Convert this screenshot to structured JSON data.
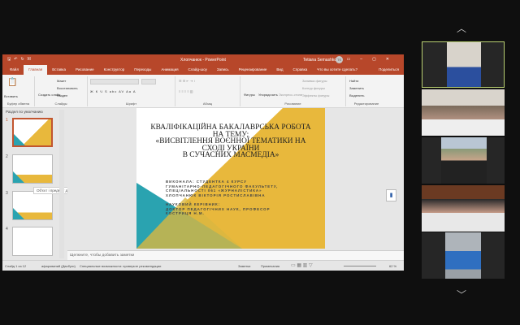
{
  "powerpoint": {
    "window_title": "Хлопчанюк - PowerPoint",
    "user_name": "Tetiana Semashko",
    "user_initials": "TS",
    "tabs": [
      "Файл",
      "Главная",
      "Вставка",
      "Рисование",
      "Конструктор",
      "Переходы",
      "Анимация",
      "Слайд-шоу",
      "Запись",
      "Рецензирование",
      "Вид",
      "Справка"
    ],
    "active_tab": "Главная",
    "tell_me": "Что вы хотите сделать?",
    "share": "Поделиться",
    "ribbon": {
      "paste": "Вставить",
      "new_slide": "Создать слайд",
      "layout": "Макет",
      "reset": "Восстановить",
      "section": "Раздел",
      "font_buttons": "Ж К Ч S abc AV Aa A",
      "shapes": "Фигуры",
      "arrange": "Упорядочить",
      "quick_styles": "Экспресс-стили",
      "shape_fill": "Заливка фигуры",
      "shape_outline": "Контур фигуры",
      "shape_effects": "Эффекты фигуры",
      "find": "Найти",
      "replace": "Заменить",
      "select": "Выделить",
      "groups": [
        "Буфер обмена",
        "Слайды",
        "Шрифт",
        "Абзац",
        "Рисование",
        "Редактирование"
      ]
    },
    "thumbnails": {
      "section_label": "Раздел по умолчанию",
      "numbers": [
        "1",
        "2",
        "3",
        "4"
      ],
      "selected": "1",
      "tooltip": "Об'єкт і предмет дослідження"
    },
    "slide": {
      "title_lines": [
        "КВАЛІФІКАЦІЙНА БАКАЛАВРСЬКА  РОБОТА",
        "НА ТЕМУ:",
        "«ВИСВІТЛЕННЯ ВОЄННОЇ ТЕМАТИКИ НА",
        "СХОДІ УКРАЇНИ",
        "В СУЧАСНИХ МАСМЕДІА»"
      ],
      "author_lines": [
        "ВИКОНАЛА: СТУДЕНТКА 4 КУРСУ",
        "ГУМАНІТАРНО-ПЕДАГОГІЧНОГО ФАКУЛЬТЕТУ,",
        "СПЕЦІАЛЬНОСТІ 061 «ЖУРНАЛІСТИКА»",
        "ХЛОПЧАНЮК ВІКТОРІЯ РОСТИСЛАВІВНА"
      ],
      "supervisor_lines": [
        "НАУКОВИЙ КЕРІВНИК:",
        "ДОКТОР ПЕДАГОГІЧНИХ НАУК, ПРОФЕСОР",
        "КОСТРИЦЯ Н.М."
      ],
      "colors": {
        "yellow": "#e8b83c",
        "teal": "#2aa3b0"
      }
    },
    "notes_placeholder": "Щелкните, чтобы добавить заметки",
    "status": {
      "slide_count": "Слайд 1 из 12",
      "theme": "афарований (Двобуги)",
      "accessibility": "Специальные возможности: проверьте рекомендации",
      "notes": "Заметки",
      "comments": "Примечания",
      "zoom": "62 %"
    }
  },
  "meeting": {
    "participants": [
      {
        "active": true,
        "bg": "#3a3a3a",
        "person": "#2b4f9e"
      },
      {
        "active": false,
        "bg": "#d9d4cc",
        "person": "#eeeeee"
      },
      {
        "active": false,
        "bg": "#8a9a78",
        "person": "#222222"
      },
      {
        "active": false,
        "bg": "#6b3a22",
        "person": "#e8e8e8"
      },
      {
        "active": false,
        "bg": "#9aa0a6",
        "person": "#2f6fc0"
      }
    ],
    "scroll_up": "︿",
    "scroll_down": "﹀"
  }
}
